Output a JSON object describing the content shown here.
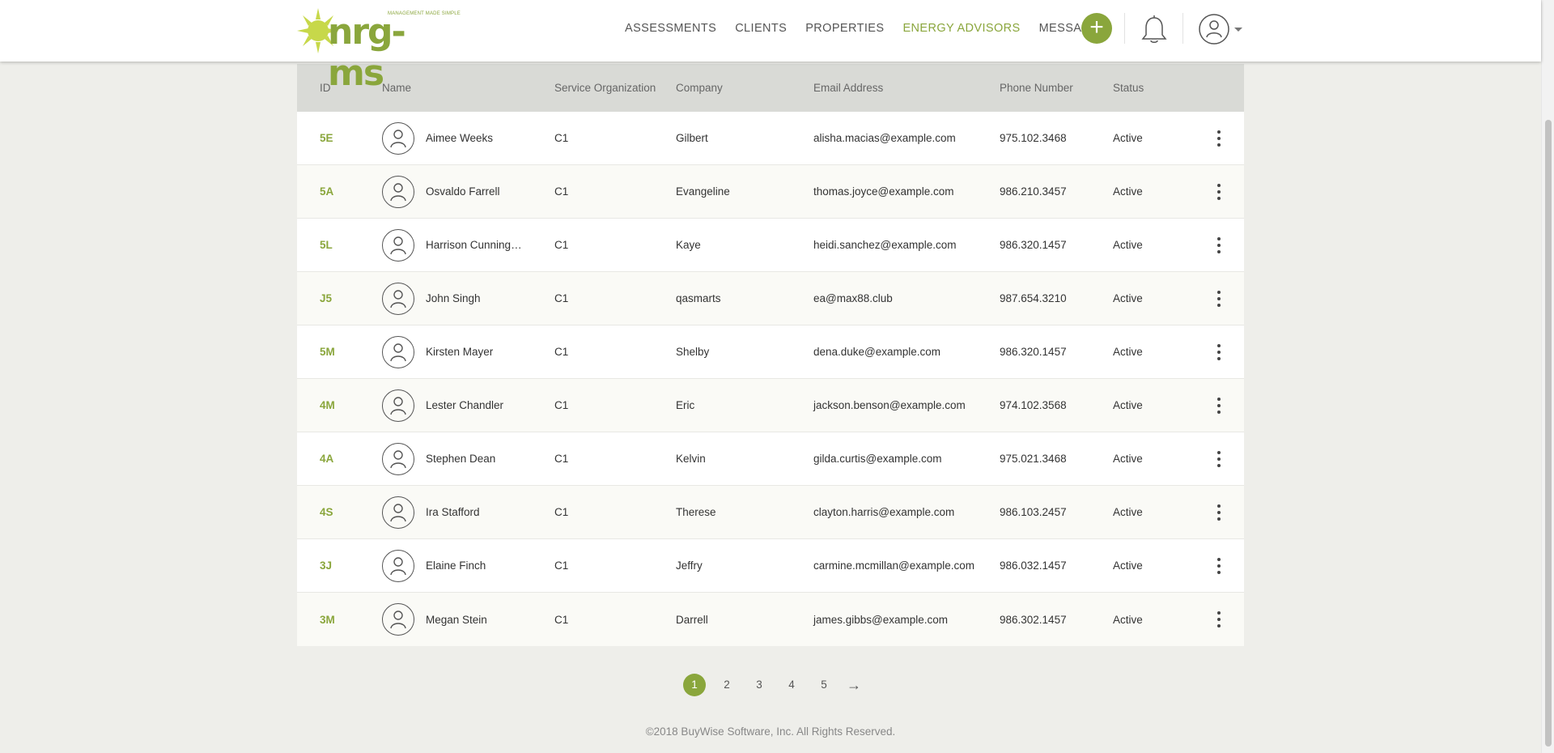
{
  "header": {
    "logo_text": "nrg-ms",
    "logo_tagline": "MANAGEMENT MADE SIMPLE",
    "nav": [
      {
        "label": "ASSESSMENTS",
        "active": false
      },
      {
        "label": "CLIENTS",
        "active": false
      },
      {
        "label": "PROPERTIES",
        "active": false
      },
      {
        "label": "ENERGY ADVISORS",
        "active": true
      },
      {
        "label": "MESSAGES",
        "active": false
      }
    ],
    "add_label": "+"
  },
  "colors": {
    "accent": "#8aa63c",
    "header_bg": "#ffffff",
    "table_head_bg": "#d9dad6",
    "page_bg": "#eeeeea"
  },
  "table": {
    "columns": [
      "ID",
      "Name",
      "Service Organization",
      "Company",
      "Email Address",
      "Phone Number",
      "Status"
    ],
    "rows": [
      {
        "id": "5E",
        "name": "Aimee Weeks",
        "org": "C1",
        "company": "Gilbert",
        "email": "alisha.macias@example.com",
        "phone": "975.102.3468",
        "status": "Active"
      },
      {
        "id": "5A",
        "name": "Osvaldo Farrell",
        "org": "C1",
        "company": "Evangeline",
        "email": "thomas.joyce@example.com",
        "phone": "986.210.3457",
        "status": "Active"
      },
      {
        "id": "5L",
        "name": "Harrison Cunningh...",
        "org": "C1",
        "company": "Kaye",
        "email": "heidi.sanchez@example.com",
        "phone": "986.320.1457",
        "status": "Active"
      },
      {
        "id": "J5",
        "name": "John Singh",
        "org": "C1",
        "company": "qasmarts",
        "email": "ea@max88.club",
        "phone": "987.654.3210",
        "status": "Active"
      },
      {
        "id": "5M",
        "name": "Kirsten Mayer",
        "org": "C1",
        "company": "Shelby",
        "email": "dena.duke@example.com",
        "phone": "986.320.1457",
        "status": "Active"
      },
      {
        "id": "4M",
        "name": "Lester Chandler",
        "org": "C1",
        "company": "Eric",
        "email": "jackson.benson@example.com",
        "phone": "974.102.3568",
        "status": "Active"
      },
      {
        "id": "4A",
        "name": "Stephen Dean",
        "org": "C1",
        "company": "Kelvin",
        "email": "gilda.curtis@example.com",
        "phone": "975.021.3468",
        "status": "Active"
      },
      {
        "id": "4S",
        "name": "Ira Stafford",
        "org": "C1",
        "company": "Therese",
        "email": "clayton.harris@example.com",
        "phone": "986.103.2457",
        "status": "Active"
      },
      {
        "id": "3J",
        "name": "Elaine Finch",
        "org": "C1",
        "company": "Jeffry",
        "email": "carmine.mcmillan@example.com",
        "phone": "986.032.1457",
        "status": "Active"
      },
      {
        "id": "3M",
        "name": "Megan Stein",
        "org": "C1",
        "company": "Darrell",
        "email": "james.gibbs@example.com",
        "phone": "986.302.1457",
        "status": "Active"
      }
    ]
  },
  "pagination": {
    "pages": [
      "1",
      "2",
      "3",
      "4",
      "5"
    ],
    "current": "1",
    "next_icon": "arrow-right-icon"
  },
  "footer": {
    "text": "©2018 BuyWise Software, Inc. All Rights Reserved."
  }
}
